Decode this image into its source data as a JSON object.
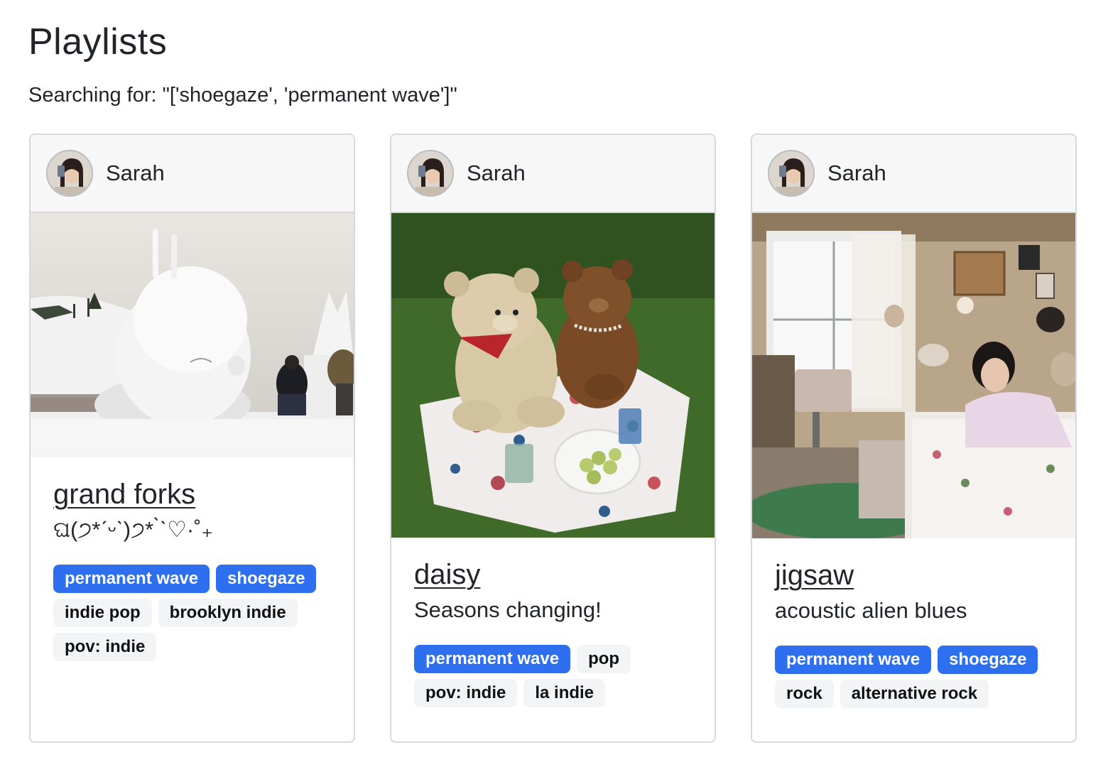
{
  "page": {
    "title": "Playlists",
    "search_text": "Searching for: \"['shoegaze', 'permanent wave']\""
  },
  "colors": {
    "match_tag": "#2e6ff0",
    "tag": "#f3f4f6",
    "card_border": "#d7d9dc"
  },
  "cards": [
    {
      "user": "Sarah",
      "name": "grand forks",
      "description": "ଘ(੭*ˊᵕˋ)੭* ̀ˋ♡·˚₊",
      "image": "snow-sculptures",
      "tags": [
        {
          "label": "permanent wave",
          "match": true
        },
        {
          "label": "shoegaze",
          "match": true
        },
        {
          "label": "indie pop",
          "match": false
        },
        {
          "label": "brooklyn indie",
          "match": false
        },
        {
          "label": "pov: indie",
          "match": false
        }
      ]
    },
    {
      "user": "Sarah",
      "name": "daisy",
      "description": "Seasons changing!",
      "image": "teddy-bear-picnic",
      "tags": [
        {
          "label": "permanent wave",
          "match": true
        },
        {
          "label": "pop",
          "match": false
        },
        {
          "label": "pov: indie",
          "match": false
        },
        {
          "label": "la indie",
          "match": false
        }
      ]
    },
    {
      "user": "Sarah",
      "name": "jigsaw",
      "description": "acoustic alien blues",
      "image": "bedroom-photo",
      "tags": [
        {
          "label": "permanent wave",
          "match": true
        },
        {
          "label": "shoegaze",
          "match": true
        },
        {
          "label": "rock",
          "match": false
        },
        {
          "label": "alternative rock",
          "match": false
        }
      ]
    }
  ]
}
